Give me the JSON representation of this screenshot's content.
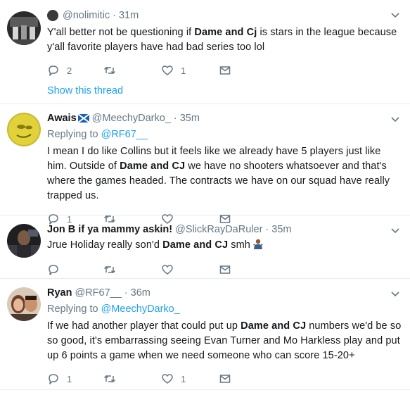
{
  "tweets": [
    {
      "name": "",
      "handle": "@nolimitic",
      "time": "31m",
      "replying_to": "",
      "text_parts": [
        "Y'all better not be questioning if ",
        "Dame and Cj",
        " is stars in the league because y'all favorite players have had bad series too lol"
      ],
      "replies": "2",
      "retweets": "",
      "likes": "1",
      "show_thread": "Show this thread"
    },
    {
      "name": "Awais",
      "handle": "@MeechyDarko_",
      "time": "35m",
      "replying_label": "Replying to ",
      "replying_to": "@RF67__",
      "text_parts": [
        "I mean I do like Collins but it feels like we already have 5 players just like him. Outside of ",
        "Dame and CJ",
        " we have no shooters whatsoever and that's where the games headed. The contracts we have on our squad have really trapped us."
      ],
      "replies": "1",
      "retweets": "",
      "likes": ""
    },
    {
      "name": "Jon B if ya mammy askin!",
      "handle": "@SlickRayDaRuler",
      "time": "35m",
      "replying_to": "",
      "text_parts": [
        "Jrue Holiday really son'd ",
        "Dame and CJ",
        " smh"
      ],
      "replies": "",
      "retweets": "",
      "likes": ""
    },
    {
      "name": "Ryan",
      "handle": "@RF67__",
      "time": "36m",
      "replying_label": "Replying to ",
      "replying_to": "@MeechyDarko_",
      "text_parts": [
        "If we had another player that could put up ",
        "Dame and CJ",
        " numbers we'd be so so good, it's embarrassing seeing Evan Turner and Mo Harkless play and put up 6 points a game when we need someone who can score 15-20+"
      ],
      "replies": "1",
      "retweets": "",
      "likes": "1"
    }
  ],
  "separator": "·",
  "colors": {
    "link": "#1da1f2",
    "muted": "#657786",
    "border": "#e6ecf0"
  },
  "icons": [
    "reply-icon",
    "retweet-icon",
    "like-icon",
    "message-icon",
    "chevron-down-icon"
  ]
}
